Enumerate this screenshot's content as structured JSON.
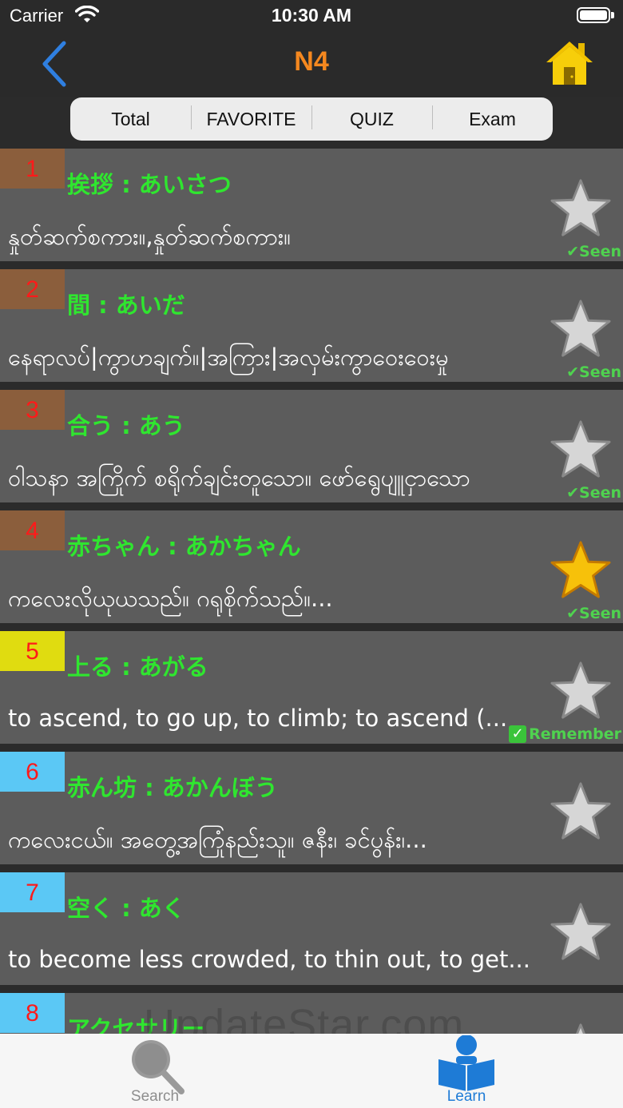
{
  "status_bar": {
    "carrier": "Carrier",
    "time": "10:30 AM"
  },
  "nav": {
    "title": "N4"
  },
  "segments": [
    "Total",
    "FAVORITE",
    "QUIZ",
    "Exam"
  ],
  "colors": {
    "accent": "#f5881f",
    "word_green": "#2fe62f",
    "number_red": "#ff1a1a",
    "tab_active": "#1e7bd6"
  },
  "rows": [
    {
      "number": "1",
      "word": "挨拶 : あいさつ",
      "meaning": "နှုတ်ဆက်စကား။,နှုတ်ဆက်စကား။",
      "favorite": false,
      "badge": "✔Seen",
      "badge_type": "seen",
      "num_color": "#8b5e3c"
    },
    {
      "number": "2",
      "word": "間 : あいだ",
      "meaning": "နေရာလပ်|ကွာဟချက်။|အကြား|အလှမ်းကွာဝေးဝေးမှု",
      "favorite": false,
      "badge": "✔Seen",
      "badge_type": "seen",
      "num_color": "#8b5e3c"
    },
    {
      "number": "3",
      "word": "合う : あう",
      "meaning": "ဝါသနာ အကြိုက် စရိုက်ချင်းတူသော။ ဖော်ရွေပျူငှာသော",
      "favorite": false,
      "badge": "✔Seen",
      "badge_type": "seen",
      "num_color": "#8b5e3c"
    },
    {
      "number": "4",
      "word": "赤ちゃん : あかちゃん",
      "meaning": "ကလေးလိုယုယသည်။ ဂရုစိုက်သည်။...",
      "favorite": true,
      "badge": "✔Seen",
      "badge_type": "seen",
      "num_color": "#8b5e3c"
    },
    {
      "number": "5",
      "word": "上る : あがる",
      "meaning": "to ascend, to go up, to climb; to ascend (...",
      "favorite": false,
      "badge": "Remember",
      "badge_type": "remember",
      "num_color": "#e0dc10"
    },
    {
      "number": "6",
      "word": "赤ん坊 : あかんぼう",
      "meaning": "ကလေးငယ်။ အတွေ့အကြုံနည်းသူ။ ဇနီး၊ ခင်ပွန်း၊...",
      "favorite": false,
      "badge": "",
      "badge_type": "none",
      "num_color": "#5bc8f5"
    },
    {
      "number": "7",
      "word": "空く : あく",
      "meaning": "to become less crowded, to thin out, to get...",
      "favorite": false,
      "badge": "",
      "badge_type": "none",
      "num_color": "#5bc8f5"
    },
    {
      "number": "8",
      "word": "アクセサリー",
      "meaning": "",
      "favorite": false,
      "badge": "",
      "badge_type": "none",
      "num_color": "#5bc8f5"
    }
  ],
  "watermark": "UpdateStar.com",
  "tabs": [
    {
      "label": "Search",
      "icon": "search-icon",
      "active": false
    },
    {
      "label": "Learn",
      "icon": "reader-icon",
      "active": true
    }
  ]
}
